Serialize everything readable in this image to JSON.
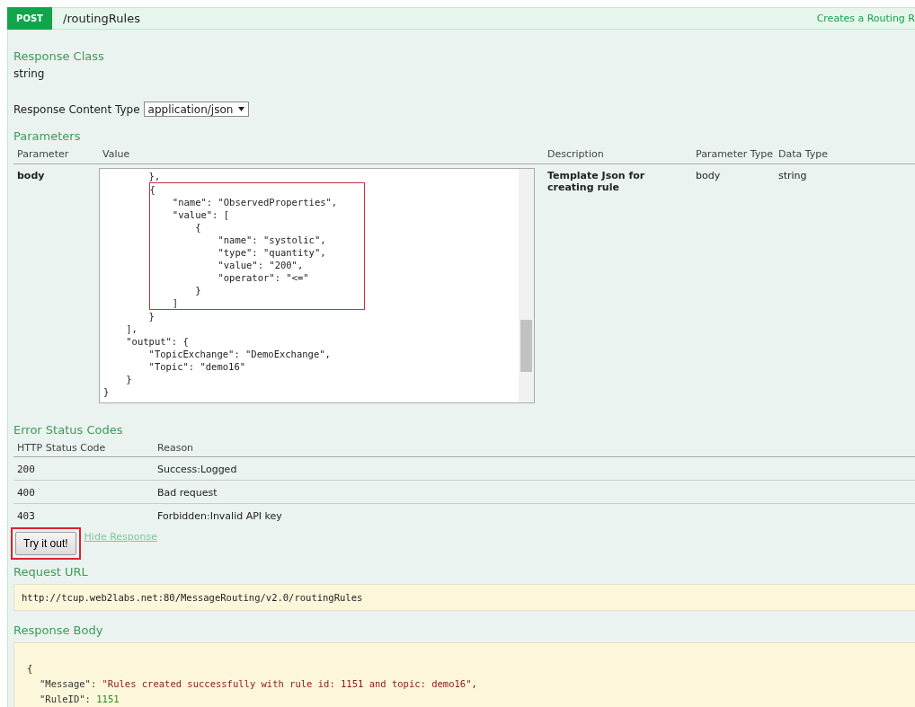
{
  "operation": {
    "method": "POST",
    "path": "/routingRules",
    "summary": "Creates a Routing R"
  },
  "response_class": {
    "heading": "Response Class",
    "value": "string"
  },
  "content_type": {
    "label": "Response Content Type",
    "value": "application/json"
  },
  "parameters": {
    "heading": "Parameters",
    "columns": [
      "Parameter",
      "Value",
      "Description",
      "Parameter Type",
      "Data Type"
    ],
    "rows": [
      {
        "name": "body",
        "description": "Template Json for creating rule",
        "parameter_type": "body",
        "data_type": "string",
        "code_before": [
          "        },"
        ],
        "highlighted_code": [
          "{",
          "    \"name\": \"ObservedProperties\",",
          "    \"value\": [",
          "        {",
          "            \"name\": \"systolic\",",
          "            \"type\": \"quantity\",",
          "            \"value\": \"200\",",
          "            \"operator\": \"<=\"",
          "        }",
          "    ]"
        ],
        "code_after": [
          "        }",
          "    ],",
          "    \"output\": {",
          "        \"TopicExchange\": \"DemoExchange\",",
          "        \"Topic\": \"demo16\"",
          "    }",
          "}"
        ]
      }
    ]
  },
  "error_status_codes": {
    "heading": "Error Status Codes",
    "columns": [
      "HTTP Status Code",
      "Reason"
    ],
    "rows": [
      {
        "code": "200",
        "reason": "Success:Logged"
      },
      {
        "code": "400",
        "reason": "Bad request"
      },
      {
        "code": "403",
        "reason": "Forbidden:Invalid API key"
      }
    ]
  },
  "try_button": {
    "label": "Try it out!",
    "highlighted": true
  },
  "hide_response_link": "Hide Response",
  "request_url": {
    "heading": "Request URL",
    "value": "http://tcup.web2labs.net:80/MessageRouting/v2.0/routingRules"
  },
  "response_body": {
    "heading": "Response Body",
    "open": "{",
    "entries": [
      {
        "key": "\"Message\":",
        "value": "\"Rules created successfully with rule id: 1151 and topic: demo16\"",
        "trailing": ",",
        "kind": "string"
      },
      {
        "key": "\"RuleID\":",
        "value": "1151",
        "kind": "number"
      }
    ]
  }
}
